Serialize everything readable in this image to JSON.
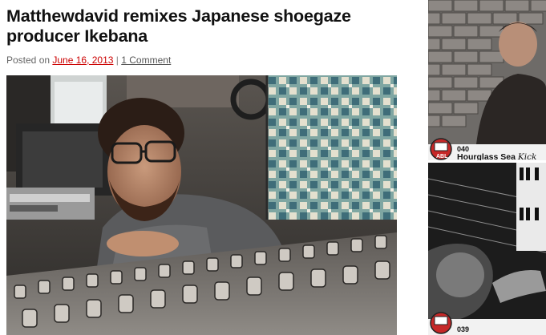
{
  "post": {
    "title": "Matthewdavid remixes Japanese shoegaze producer Ikebana",
    "meta_prefix": "Posted on ",
    "date": "June 16, 2013",
    "separator": " | ",
    "comments": "1 Comment"
  },
  "sidebar": {
    "items": [
      {
        "number": "040",
        "name": "Hourglass Sea",
        "extra": "Kick"
      },
      {
        "number": "039",
        "name": "",
        "extra": ""
      }
    ]
  },
  "colors": {
    "link": "#cc0000",
    "badge_red": "#c62828"
  }
}
